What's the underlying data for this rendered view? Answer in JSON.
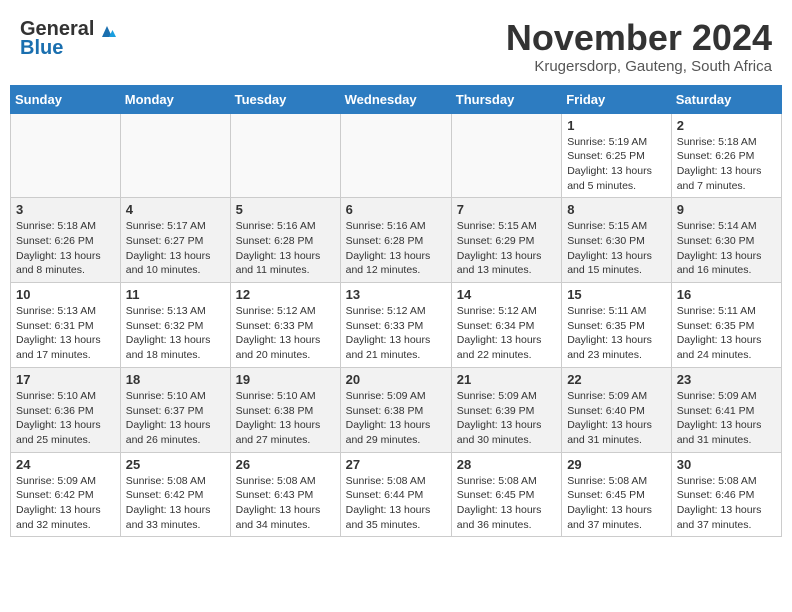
{
  "header": {
    "logo_general": "General",
    "logo_blue": "Blue",
    "month": "November 2024",
    "location": "Krugersdorp, Gauteng, South Africa"
  },
  "weekdays": [
    "Sunday",
    "Monday",
    "Tuesday",
    "Wednesday",
    "Thursday",
    "Friday",
    "Saturday"
  ],
  "weeks": [
    [
      {
        "day": "",
        "info": ""
      },
      {
        "day": "",
        "info": ""
      },
      {
        "day": "",
        "info": ""
      },
      {
        "day": "",
        "info": ""
      },
      {
        "day": "",
        "info": ""
      },
      {
        "day": "1",
        "info": "Sunrise: 5:19 AM\nSunset: 6:25 PM\nDaylight: 13 hours and 5 minutes."
      },
      {
        "day": "2",
        "info": "Sunrise: 5:18 AM\nSunset: 6:26 PM\nDaylight: 13 hours and 7 minutes."
      }
    ],
    [
      {
        "day": "3",
        "info": "Sunrise: 5:18 AM\nSunset: 6:26 PM\nDaylight: 13 hours and 8 minutes."
      },
      {
        "day": "4",
        "info": "Sunrise: 5:17 AM\nSunset: 6:27 PM\nDaylight: 13 hours and 10 minutes."
      },
      {
        "day": "5",
        "info": "Sunrise: 5:16 AM\nSunset: 6:28 PM\nDaylight: 13 hours and 11 minutes."
      },
      {
        "day": "6",
        "info": "Sunrise: 5:16 AM\nSunset: 6:28 PM\nDaylight: 13 hours and 12 minutes."
      },
      {
        "day": "7",
        "info": "Sunrise: 5:15 AM\nSunset: 6:29 PM\nDaylight: 13 hours and 13 minutes."
      },
      {
        "day": "8",
        "info": "Sunrise: 5:15 AM\nSunset: 6:30 PM\nDaylight: 13 hours and 15 minutes."
      },
      {
        "day": "9",
        "info": "Sunrise: 5:14 AM\nSunset: 6:30 PM\nDaylight: 13 hours and 16 minutes."
      }
    ],
    [
      {
        "day": "10",
        "info": "Sunrise: 5:13 AM\nSunset: 6:31 PM\nDaylight: 13 hours and 17 minutes."
      },
      {
        "day": "11",
        "info": "Sunrise: 5:13 AM\nSunset: 6:32 PM\nDaylight: 13 hours and 18 minutes."
      },
      {
        "day": "12",
        "info": "Sunrise: 5:12 AM\nSunset: 6:33 PM\nDaylight: 13 hours and 20 minutes."
      },
      {
        "day": "13",
        "info": "Sunrise: 5:12 AM\nSunset: 6:33 PM\nDaylight: 13 hours and 21 minutes."
      },
      {
        "day": "14",
        "info": "Sunrise: 5:12 AM\nSunset: 6:34 PM\nDaylight: 13 hours and 22 minutes."
      },
      {
        "day": "15",
        "info": "Sunrise: 5:11 AM\nSunset: 6:35 PM\nDaylight: 13 hours and 23 minutes."
      },
      {
        "day": "16",
        "info": "Sunrise: 5:11 AM\nSunset: 6:35 PM\nDaylight: 13 hours and 24 minutes."
      }
    ],
    [
      {
        "day": "17",
        "info": "Sunrise: 5:10 AM\nSunset: 6:36 PM\nDaylight: 13 hours and 25 minutes."
      },
      {
        "day": "18",
        "info": "Sunrise: 5:10 AM\nSunset: 6:37 PM\nDaylight: 13 hours and 26 minutes."
      },
      {
        "day": "19",
        "info": "Sunrise: 5:10 AM\nSunset: 6:38 PM\nDaylight: 13 hours and 27 minutes."
      },
      {
        "day": "20",
        "info": "Sunrise: 5:09 AM\nSunset: 6:38 PM\nDaylight: 13 hours and 29 minutes."
      },
      {
        "day": "21",
        "info": "Sunrise: 5:09 AM\nSunset: 6:39 PM\nDaylight: 13 hours and 30 minutes."
      },
      {
        "day": "22",
        "info": "Sunrise: 5:09 AM\nSunset: 6:40 PM\nDaylight: 13 hours and 31 minutes."
      },
      {
        "day": "23",
        "info": "Sunrise: 5:09 AM\nSunset: 6:41 PM\nDaylight: 13 hours and 31 minutes."
      }
    ],
    [
      {
        "day": "24",
        "info": "Sunrise: 5:09 AM\nSunset: 6:42 PM\nDaylight: 13 hours and 32 minutes."
      },
      {
        "day": "25",
        "info": "Sunrise: 5:08 AM\nSunset: 6:42 PM\nDaylight: 13 hours and 33 minutes."
      },
      {
        "day": "26",
        "info": "Sunrise: 5:08 AM\nSunset: 6:43 PM\nDaylight: 13 hours and 34 minutes."
      },
      {
        "day": "27",
        "info": "Sunrise: 5:08 AM\nSunset: 6:44 PM\nDaylight: 13 hours and 35 minutes."
      },
      {
        "day": "28",
        "info": "Sunrise: 5:08 AM\nSunset: 6:45 PM\nDaylight: 13 hours and 36 minutes."
      },
      {
        "day": "29",
        "info": "Sunrise: 5:08 AM\nSunset: 6:45 PM\nDaylight: 13 hours and 37 minutes."
      },
      {
        "day": "30",
        "info": "Sunrise: 5:08 AM\nSunset: 6:46 PM\nDaylight: 13 hours and 37 minutes."
      }
    ]
  ]
}
